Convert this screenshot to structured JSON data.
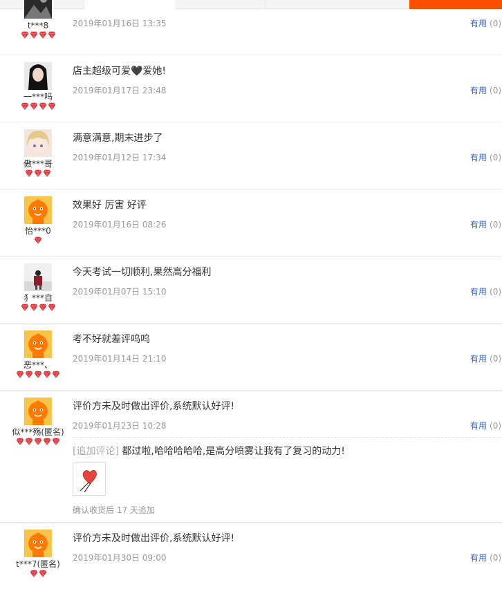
{
  "tabs": [
    "",
    "",
    "",
    ""
  ],
  "accent_color": "#ff5000",
  "useful_label": "有用",
  "reviews": [
    {
      "username": "t***8",
      "avatar": "dark-photo-avatar",
      "rank_gems": 4,
      "content": "",
      "date": "2019年01月16日 13:35",
      "useful_count": "(0)"
    },
    {
      "username": "一***吗",
      "avatar": "girl-dark-hair-avatar",
      "rank_gems": 4,
      "content": "店主超级可爱🖤爱她!",
      "date": "2019年01月17日 23:48",
      "useful_count": "(0)"
    },
    {
      "username": "傲***哥",
      "avatar": "anime-blond-avatar",
      "rank_gems": 3,
      "content": "满意满意,期末进步了",
      "date": "2019年01月12日 17:34",
      "useful_count": "(0)"
    },
    {
      "username": "怡***0",
      "avatar": "taobao-default-avatar",
      "rank_gems": 1,
      "content": "效果好 厉害 好评",
      "date": "2019年01月16日 08:26",
      "useful_count": "(0)"
    },
    {
      "username": "犭***自",
      "avatar": "person-sitting-avatar",
      "rank_gems": 4,
      "content": "今天考试一切顺利,果然高分福利",
      "date": "2019年01月07日 15:10",
      "useful_count": "(0)"
    },
    {
      "username": "恶***、",
      "avatar": "taobao-default-avatar",
      "rank_gems": 5,
      "content": "考不好就差评呜呜",
      "date": "2019年01月14日 21:10",
      "useful_count": "(0)"
    },
    {
      "username": "似***殇(匿名)",
      "avatar": "taobao-default-avatar",
      "rank_gems": 5,
      "content": "评价方未及时做出评价,系统默认好评!",
      "date": "2019年01月23日 10:28",
      "useful_count": "(0)",
      "append": {
        "label": "[追加评论]",
        "text": "都过啦,哈哈哈哈哈,是高分喷雾让我有了复习的动力!",
        "image": "heart-image",
        "note": "确认收货后 17 天追加"
      }
    },
    {
      "username": "t***7(匿名)",
      "avatar": "taobao-default-avatar",
      "rank_gems": 2,
      "content": "评价方未及时做出评价,系统默认好评!",
      "date": "2019年01月30日 09:00",
      "useful_count": "(0)"
    }
  ]
}
